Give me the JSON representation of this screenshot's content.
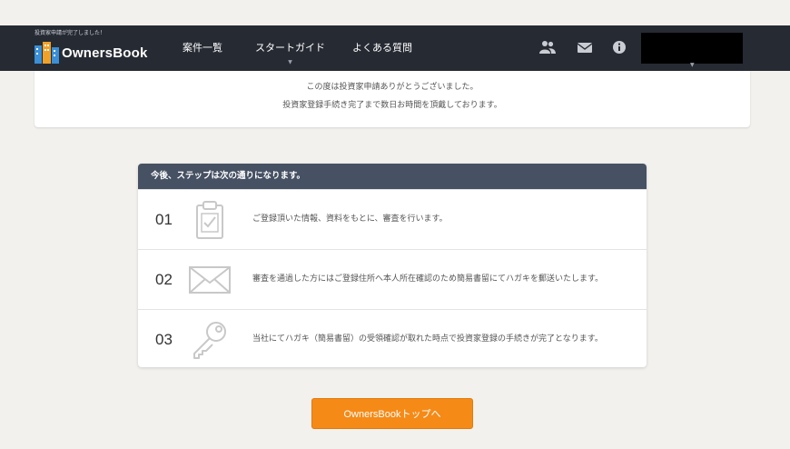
{
  "header": {
    "tagline": "投資家申請が完了しました！",
    "brand_name": "OwnersBook",
    "nav": [
      {
        "label": "案件一覧"
      },
      {
        "label": "スタートガイド"
      },
      {
        "label": "よくある質問"
      }
    ],
    "icons": [
      "users-icon",
      "mail-icon",
      "info-icon"
    ]
  },
  "message": {
    "line1": "この度は投資家申請ありがとうございました。",
    "line2": "投資家登録手続き完了まで数日お時間を頂戴しております。"
  },
  "steps": {
    "title": "今後、ステップは次の通りになります。",
    "items": [
      {
        "num": "01",
        "icon": "clipboard-check-icon",
        "text": "ご登録頂いた情報、資料をもとに、審査を行います。"
      },
      {
        "num": "02",
        "icon": "envelope-icon",
        "text": "審査を通過した方にはご登録住所へ本人所在確認のため簡易書留にてハガキを郵送いたします。"
      },
      {
        "num": "03",
        "icon": "key-icon",
        "text": "当社にてハガキ（簡易書留）の受領確認が取れた時点で投資家登録の手続きが完了となります。"
      }
    ]
  },
  "cta": {
    "label": "OwnersBookトップへ"
  },
  "colors": {
    "navbar": "#262a33",
    "steps_header": "#465163",
    "cta": "#f58a17",
    "background": "#f2f1ee"
  }
}
